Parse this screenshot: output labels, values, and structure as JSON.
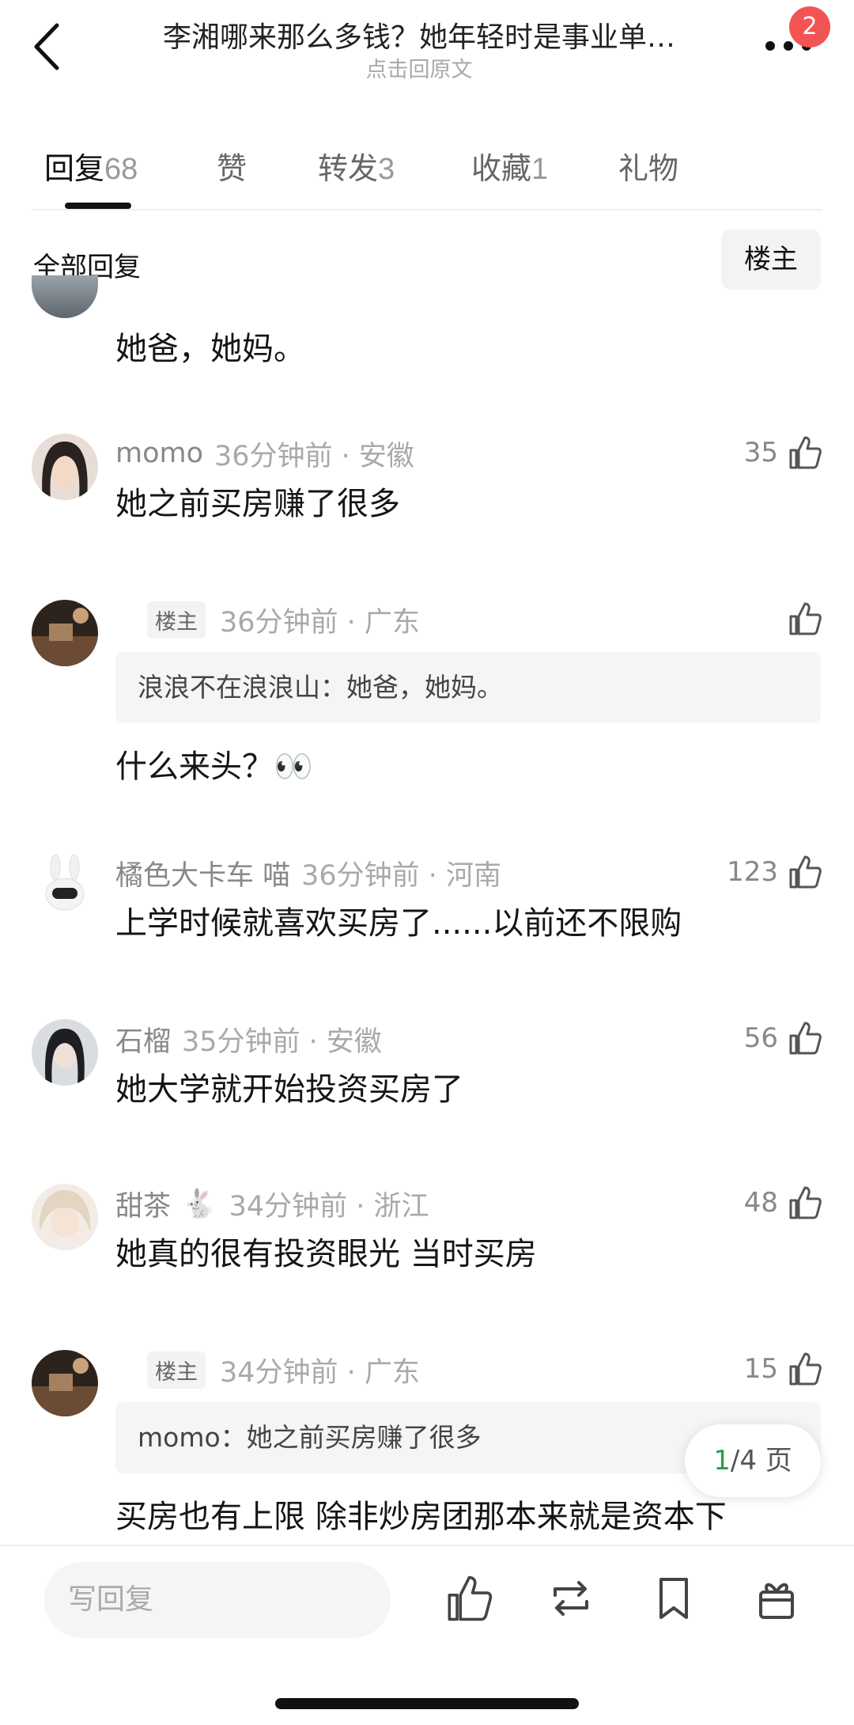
{
  "header": {
    "title": "李湘哪来那么多钱？她年轻时是事业单…",
    "subtitle": "点击回原文",
    "badge_count": "2"
  },
  "tabs": [
    {
      "label": "回复",
      "count": "68",
      "active": true
    },
    {
      "label": "赞",
      "count": ""
    },
    {
      "label": "转发",
      "count": "3"
    },
    {
      "label": "收藏",
      "count": "1"
    },
    {
      "label": "礼物",
      "count": ""
    }
  ],
  "filter": {
    "label": "全部回复",
    "owner_button": "楼主"
  },
  "comments": [
    {
      "content": "她爸，她妈。"
    },
    {
      "name": "momo",
      "time": "36分钟前 · 安徽",
      "likes": "35",
      "content": "她之前买房赚了很多"
    },
    {
      "op_tag": "楼主",
      "time": "36分钟前 · 广东",
      "likes": "",
      "quote": "浪浪不在浪浪山：她爸，她妈。",
      "content": "什么来头？👀"
    },
    {
      "name": "橘色大卡车 喵",
      "time": "36分钟前 · 河南",
      "likes": "123",
      "content": "上学时候就喜欢买房了......以前还不限购"
    },
    {
      "name": "石榴",
      "time": "35分钟前 · 安徽",
      "likes": "56",
      "content": "她大学就开始投资买房了"
    },
    {
      "name": "甜茶",
      "badge": "🐇",
      "time": "34分钟前 · 浙江",
      "likes": "48",
      "content": "她真的很有投资眼光 当时买房"
    },
    {
      "op_tag": "楼主",
      "time": "34分钟前 · 广东",
      "likes": "15",
      "quote": "momo：她之前买房赚了很多",
      "content": "买房也有上限  除非炒房团那本来就是资本下"
    }
  ],
  "pager": {
    "current": "1",
    "total_text": "/4 页"
  },
  "bottom": {
    "reply_placeholder": "写回复"
  }
}
